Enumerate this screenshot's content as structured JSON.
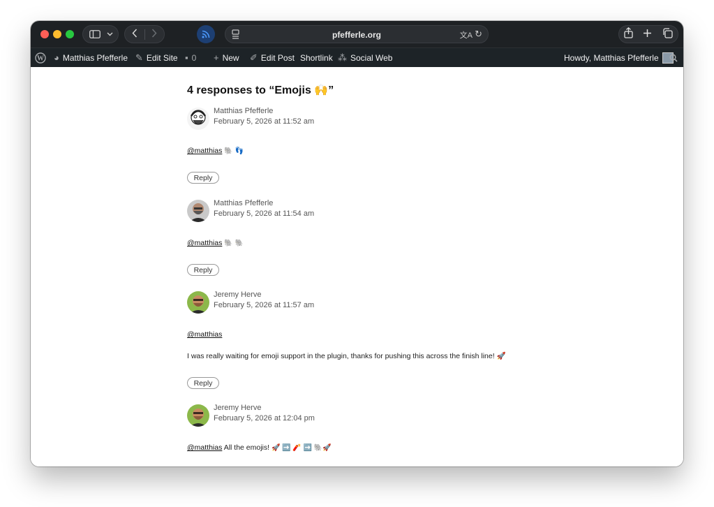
{
  "browser": {
    "url": "pfefferle.org"
  },
  "admin_bar": {
    "site_name": "Matthias Pfefferle",
    "edit_site": "Edit Site",
    "comments_count": "0",
    "new": "New",
    "edit_post": "Edit Post",
    "shortlink": "Shortlink",
    "social_web": "Social Web",
    "howdy": "Howdy, Matthias Pfefferle"
  },
  "comments": {
    "heading": "4 responses to “Emojis 🙌”",
    "reply_label": "Reply",
    "items": [
      {
        "author": "Matthias Pfefferle",
        "date": "February 5, 2026 at 11:52 am",
        "mention": "@matthias",
        "text": "",
        "emojis": "🐘 👣"
      },
      {
        "author": "Matthias Pfefferle",
        "date": "February 5, 2026 at 11:54 am",
        "mention": "@matthias",
        "text": "",
        "emojis": "🐘 🐘"
      },
      {
        "author": "Jeremy Herve",
        "date": "February 5, 2026 at 11:57 am",
        "mention": "@matthias",
        "text": "I was really waiting for emoji support in the plugin, thanks for pushing this across the finish line! 🚀",
        "emojis": ""
      },
      {
        "author": "Jeremy Herve",
        "date": "February 5, 2026 at 12:04 pm",
        "mention": "@matthias",
        "text": "All the emojis!",
        "emojis": "🚀 ➡️ 🧨 ➡️ 🐘🚀"
      }
    ]
  }
}
